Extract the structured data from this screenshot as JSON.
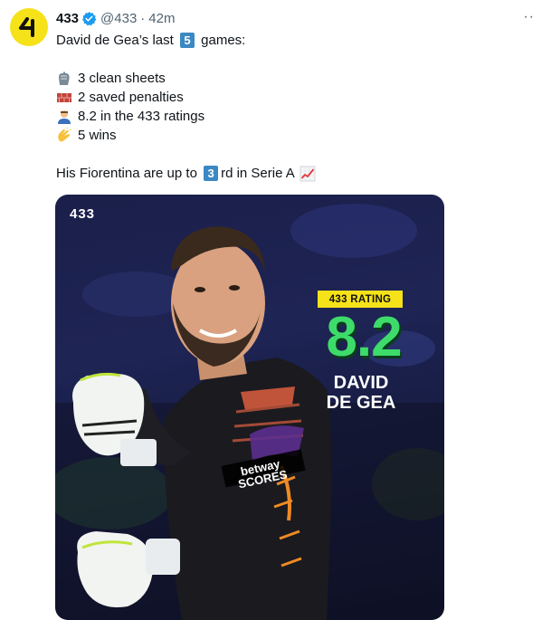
{
  "tweet": {
    "author_name": "433",
    "handle": "@433",
    "separator": "·",
    "time": "42m",
    "more_label": "··",
    "lines": {
      "l1_before": "David de Gea’s last ",
      "l1_key": "5",
      "l1_after": " games:",
      "l2": "3 clean sheets",
      "l3": "2 saved penalties",
      "l4": "8.2 in the 433 ratings",
      "l5": "5 wins",
      "l6_before": "His Fiorentina are up to ",
      "l6_key": "3",
      "l6_after": "rd in Serie A"
    },
    "icons": {
      "l2": "gloves-icon",
      "l3": "brick-icon",
      "l4": "goalkeeper-icon",
      "l5": "clapping-hands-icon",
      "l6": "chart-increasing-icon"
    }
  },
  "media": {
    "logo_text": "433",
    "badge": "433 RATING",
    "rating": "8.2",
    "player_line1": "DAVID",
    "player_line2": "DE GEA",
    "sponsor_text": "betway SCORES"
  },
  "colors": {
    "brand_yellow": "#f5e219",
    "verified_blue": "#1d9bf0",
    "keycap_blue": "#3b88c3",
    "rating_green": "#3ddc6a"
  }
}
